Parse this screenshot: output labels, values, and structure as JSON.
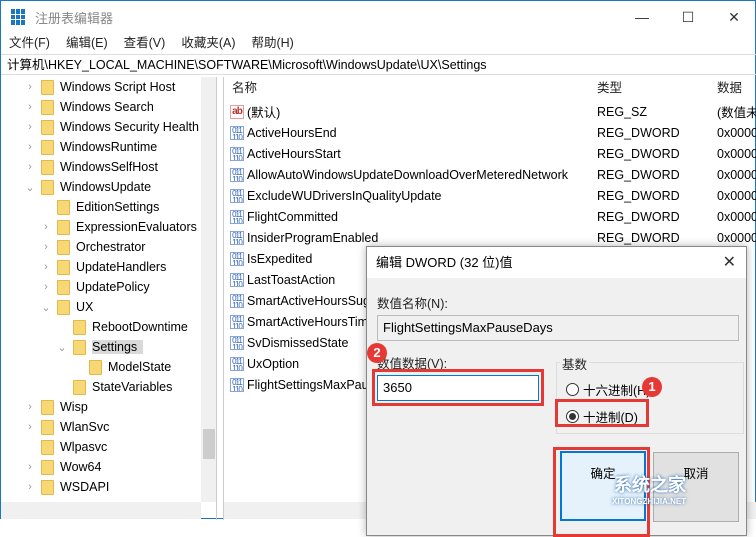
{
  "window": {
    "title": "注册表编辑器",
    "minimize": "—",
    "maximize": "☐",
    "close": "✕"
  },
  "menu": [
    "文件(F)",
    "编辑(E)",
    "查看(V)",
    "收藏夹(A)",
    "帮助(H)"
  ],
  "address": "计算机\\HKEY_LOCAL_MACHINE\\SOFTWARE\\Microsoft\\WindowsUpdate\\UX\\Settings",
  "tree": [
    {
      "label": "Windows Script Host",
      "level": 0,
      "expander": "›"
    },
    {
      "label": "Windows Search",
      "level": 0,
      "expander": "›"
    },
    {
      "label": "Windows Security Health",
      "level": 0,
      "expander": "›"
    },
    {
      "label": "WindowsRuntime",
      "level": 0,
      "expander": "›"
    },
    {
      "label": "WindowsSelfHost",
      "level": 0,
      "expander": "›"
    },
    {
      "label": "WindowsUpdate",
      "level": 0,
      "expander": "⌄"
    },
    {
      "label": "EditionSettings",
      "level": 1,
      "expander": ""
    },
    {
      "label": "ExpressionEvaluators",
      "level": 1,
      "expander": "›"
    },
    {
      "label": "Orchestrator",
      "level": 1,
      "expander": "›"
    },
    {
      "label": "UpdateHandlers",
      "level": 1,
      "expander": "›"
    },
    {
      "label": "UpdatePolicy",
      "level": 1,
      "expander": "›"
    },
    {
      "label": "UX",
      "level": 1,
      "expander": "⌄"
    },
    {
      "label": "RebootDowntime",
      "level": 2,
      "expander": ""
    },
    {
      "label": "Settings",
      "level": 2,
      "expander": "⌄",
      "selected": true
    },
    {
      "label": "ModelState",
      "level": 3,
      "expander": ""
    },
    {
      "label": "StateVariables",
      "level": 2,
      "expander": ""
    },
    {
      "label": "Wisp",
      "level": 0,
      "expander": "›"
    },
    {
      "label": "WlanSvc",
      "level": 0,
      "expander": "›"
    },
    {
      "label": "Wlpasvc",
      "level": 0,
      "expander": ""
    },
    {
      "label": "Wow64",
      "level": 0,
      "expander": "›"
    },
    {
      "label": "WSDAPI",
      "level": 0,
      "expander": "›"
    }
  ],
  "list": {
    "headers": {
      "name": "名称",
      "type": "类型",
      "data": "数据"
    },
    "rows": [
      {
        "name": "(默认)",
        "type": "REG_SZ",
        "data": "(数值未",
        "icon": "string-value-icon"
      },
      {
        "name": "ActiveHoursEnd",
        "type": "REG_DWORD",
        "data": "0x0000",
        "icon": "binary-value-icon"
      },
      {
        "name": "ActiveHoursStart",
        "type": "REG_DWORD",
        "data": "0x0000",
        "icon": "binary-value-icon"
      },
      {
        "name": "AllowAutoWindowsUpdateDownloadOverMeteredNetwork",
        "type": "REG_DWORD",
        "data": "0x0000",
        "icon": "binary-value-icon"
      },
      {
        "name": "ExcludeWUDriversInQualityUpdate",
        "type": "REG_DWORD",
        "data": "0x0000",
        "icon": "binary-value-icon"
      },
      {
        "name": "FlightCommitted",
        "type": "REG_DWORD",
        "data": "0x0000",
        "icon": "binary-value-icon"
      },
      {
        "name": "InsiderProgramEnabled",
        "type": "REG_DWORD",
        "data": "0x0000",
        "icon": "binary-value-icon"
      },
      {
        "name": "IsExpedited",
        "type": "",
        "data": "",
        "icon": "binary-value-icon"
      },
      {
        "name": "LastToastAction",
        "type": "",
        "data": "",
        "icon": "binary-value-icon"
      },
      {
        "name": "SmartActiveHoursSuggestionState",
        "type": "",
        "data": "",
        "icon": "binary-value-icon"
      },
      {
        "name": "SmartActiveHoursTimestamp",
        "type": "",
        "data": "",
        "icon": "binary-value-icon"
      },
      {
        "name": "SvDismissedState",
        "type": "",
        "data": "",
        "icon": "binary-value-icon"
      },
      {
        "name": "UxOption",
        "type": "",
        "data": "",
        "icon": "binary-value-icon"
      },
      {
        "name": "FlightSettingsMaxPauseDays",
        "type": "",
        "data": "",
        "icon": "binary-value-icon"
      }
    ]
  },
  "dialog": {
    "title": "编辑 DWORD (32 位)值",
    "close": "✕",
    "name_label": "数值名称(N):",
    "name_value": "FlightSettingsMaxPauseDays",
    "data_label": "数值数据(V):",
    "data_value": "3650",
    "radix_label": "基数",
    "hex_label": "十六进制(H)",
    "dec_label": "十进制(D)",
    "selected_radix": "dec",
    "ok": "确定",
    "cancel": "取消",
    "badge1": "1",
    "badge2": "2",
    "highlight_color": "#e53935"
  },
  "watermark": {
    "line1": "系统之家",
    "line2": "XITONGZHIJIA.NET"
  }
}
